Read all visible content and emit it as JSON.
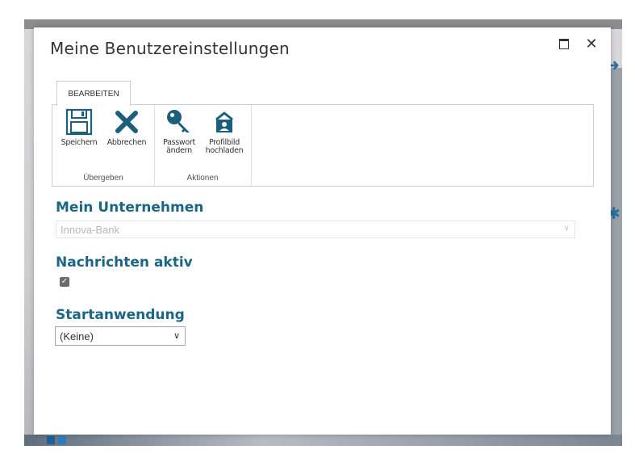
{
  "dialog": {
    "title": "Meine Benutzereinstellungen",
    "maximize_icon": "maximize-icon",
    "close_icon": "close-icon",
    "close_glyph": "✕"
  },
  "ribbon": {
    "tab": "BEARBEITEN",
    "groups": [
      {
        "label": "Übergeben",
        "buttons": [
          {
            "label": "Speichern",
            "icon": "save-icon"
          },
          {
            "label": "Abbrechen",
            "icon": "cancel-x-icon"
          }
        ]
      },
      {
        "label": "Aktionen",
        "buttons": [
          {
            "label_line1": "Passwort",
            "label_line2": "ändern",
            "icon": "key-icon"
          },
          {
            "label_line1": "Profilbild",
            "label_line2": "hochladen",
            "icon": "upload-profile-icon"
          }
        ]
      }
    ]
  },
  "form": {
    "company": {
      "label": "Mein Unternehmen",
      "value": "Innova-Bank",
      "disabled": true
    },
    "notifications": {
      "label": "Nachrichten aktiv",
      "checked": true
    },
    "start_app": {
      "label": "Startanwendung",
      "value": "(Keine)"
    }
  },
  "colors": {
    "accent": "#1b6585",
    "icon": "#1c5f7d"
  }
}
